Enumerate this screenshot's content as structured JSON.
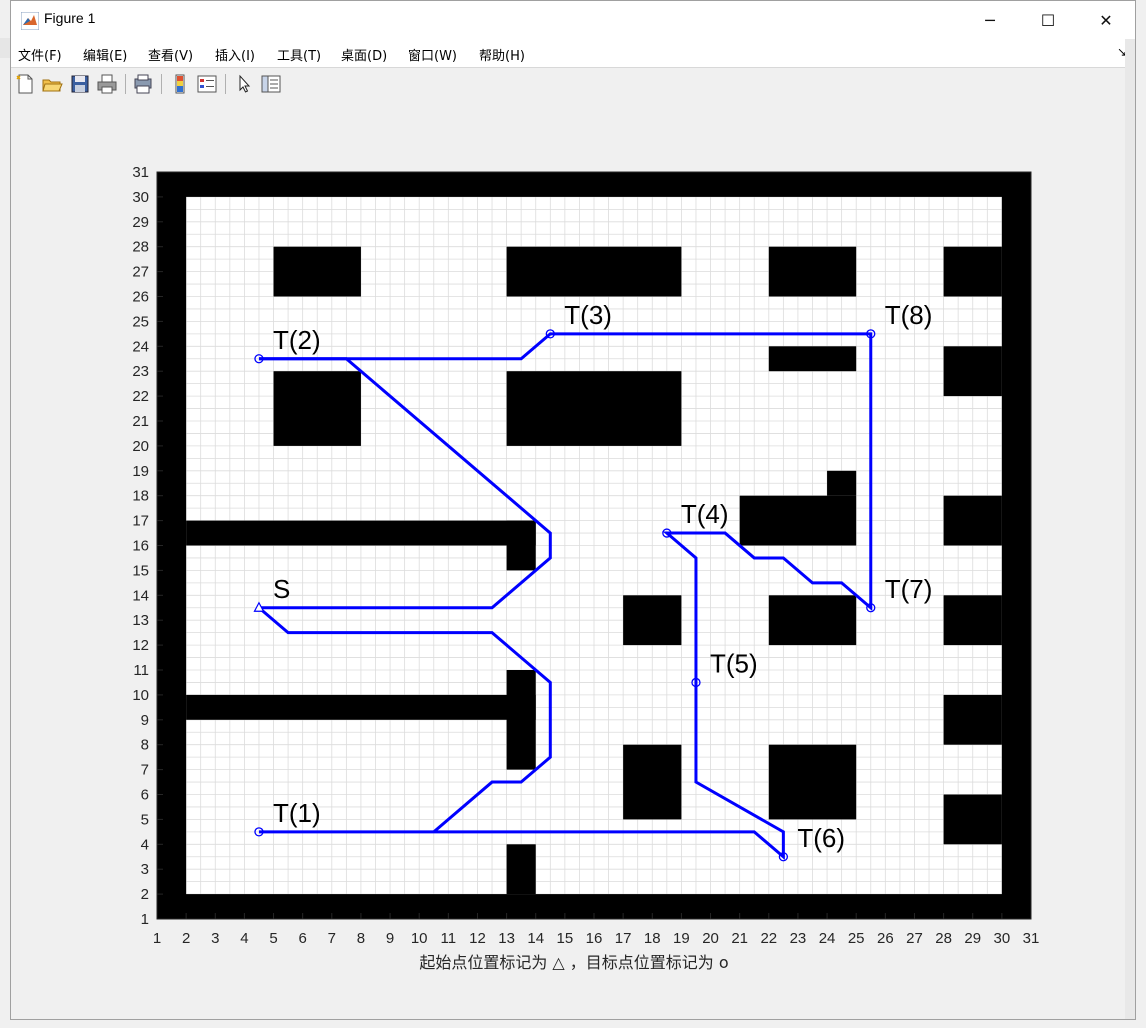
{
  "window": {
    "title": "Figure 1",
    "minimize_glyph": "─",
    "maximize_glyph": "☐",
    "close_glyph": "✕"
  },
  "menu": {
    "items": [
      "文件(F)",
      "编辑(E)",
      "查看(V)",
      "插入(I)",
      "工具(T)",
      "桌面(D)",
      "窗口(W)",
      "帮助(H)"
    ],
    "overflow_glyph": "↘"
  },
  "toolbar": {
    "icons": [
      "new-figure-icon",
      "open-file-icon",
      "save-icon",
      "print-icon",
      "print-preview-icon",
      "colorbar-icon",
      "legend-icon",
      "pointer-icon",
      "property-inspector-icon"
    ]
  },
  "colors": {
    "path": "#0000ff",
    "obstacle": "#000000",
    "grid": "#dcdcdc"
  },
  "chart_data": {
    "type": "line",
    "xlabel": "起始点位置标记为 △ ，目标点位置标记为 o",
    "ylabel": "",
    "title": "",
    "xlim": [
      1,
      31
    ],
    "ylim": [
      1,
      31
    ],
    "xticks": [
      "1",
      "2",
      "3",
      "4",
      "5",
      "6",
      "7",
      "8",
      "9",
      "10",
      "11",
      "12",
      "13",
      "14",
      "15",
      "16",
      "17",
      "18",
      "19",
      "20",
      "21",
      "22",
      "23",
      "24",
      "25",
      "26",
      "27",
      "28",
      "29",
      "30",
      "31"
    ],
    "yticks": [
      "1",
      "2",
      "3",
      "4",
      "5",
      "6",
      "7",
      "8",
      "9",
      "10",
      "11",
      "12",
      "13",
      "14",
      "15",
      "16",
      "17",
      "18",
      "19",
      "20",
      "21",
      "22",
      "23",
      "24",
      "25",
      "26",
      "27",
      "28",
      "29",
      "30",
      "31"
    ],
    "grid": true,
    "obstacles": [
      [
        1,
        1,
        2,
        31
      ],
      [
        30,
        1,
        31,
        31
      ],
      [
        1,
        1,
        31,
        2
      ],
      [
        1,
        30,
        31,
        31
      ],
      [
        5,
        26,
        8,
        28
      ],
      [
        5,
        20,
        8,
        23
      ],
      [
        13,
        26,
        19,
        28
      ],
      [
        13,
        20,
        19,
        23
      ],
      [
        22,
        26,
        25,
        28
      ],
      [
        22,
        23,
        25,
        24
      ],
      [
        28,
        26,
        30,
        28
      ],
      [
        28,
        22,
        30,
        24
      ],
      [
        2,
        16,
        14,
        17
      ],
      [
        13,
        15,
        14,
        17
      ],
      [
        21,
        16,
        25,
        18
      ],
      [
        24,
        18,
        25,
        19
      ],
      [
        28,
        16,
        30,
        18
      ],
      [
        17,
        12,
        19,
        14
      ],
      [
        22,
        12,
        25,
        14
      ],
      [
        28,
        12,
        30,
        14
      ],
      [
        2,
        9,
        14,
        10
      ],
      [
        13,
        7,
        14,
        11
      ],
      [
        28,
        8,
        30,
        10
      ],
      [
        17,
        5,
        19,
        8
      ],
      [
        22,
        5,
        25,
        8
      ],
      [
        28,
        4,
        30,
        6
      ],
      [
        13,
        2,
        14,
        4
      ]
    ],
    "start": {
      "label": "S",
      "x": 4.5,
      "y": 13.5
    },
    "targets": [
      {
        "label": "T(1)",
        "x": 4.5,
        "y": 4.5
      },
      {
        "label": "T(2)",
        "x": 4.5,
        "y": 23.5
      },
      {
        "label": "T(3)",
        "x": 14.5,
        "y": 24.5
      },
      {
        "label": "T(4)",
        "x": 18.5,
        "y": 16.5
      },
      {
        "label": "T(5)",
        "x": 19.5,
        "y": 10.5
      },
      {
        "label": "T(6)",
        "x": 22.5,
        "y": 3.5
      },
      {
        "label": "T(7)",
        "x": 25.5,
        "y": 13.5
      },
      {
        "label": "T(8)",
        "x": 25.5,
        "y": 24.5
      }
    ],
    "series": [
      {
        "x": [
          4.5,
          12.5,
          14.5,
          14.5,
          7.5,
          4.5
        ],
        "y": [
          13.5,
          13.5,
          15.5,
          16.5,
          23.5,
          23.5
        ]
      },
      {
        "x": [
          4.5,
          13.5,
          14.5,
          25.5,
          25.5,
          24.5,
          23.5,
          22.5,
          21.5,
          20.5,
          18.5,
          19.5,
          19.5,
          22.5,
          22.5,
          21.5,
          4.5
        ],
        "y": [
          23.5,
          23.5,
          24.5,
          24.5,
          13.5,
          14.5,
          14.5,
          15.5,
          15.5,
          16.5,
          16.5,
          15.5,
          6.5,
          4.5,
          3.5,
          4.5,
          4.5
        ]
      },
      {
        "x": [
          10.5,
          12.5,
          13.5,
          14.5,
          14.5,
          12.5,
          5.5,
          4.5
        ],
        "y": [
          4.5,
          6.5,
          6.5,
          7.5,
          10.5,
          12.5,
          12.5,
          13.5
        ]
      }
    ]
  }
}
